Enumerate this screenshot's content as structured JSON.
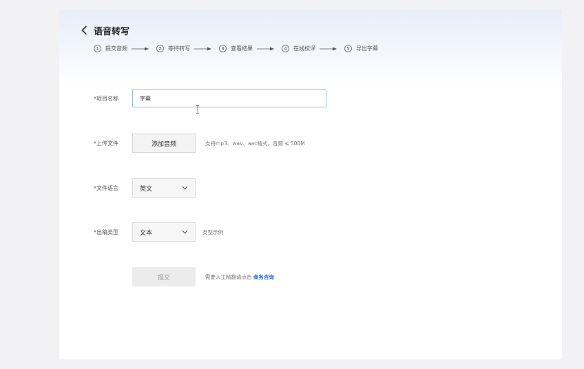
{
  "header": {
    "title": "语音转写"
  },
  "steps": [
    {
      "num": "1",
      "label": "提交音频"
    },
    {
      "num": "2",
      "label": "等待转写"
    },
    {
      "num": "3",
      "label": "查看结果"
    },
    {
      "num": "4",
      "label": "在线校译"
    },
    {
      "num": "5",
      "label": "导出字幕"
    }
  ],
  "form": {
    "project_name": {
      "label": "*项目名称",
      "value": "字幕"
    },
    "upload": {
      "label": "*上传文件",
      "button": "添加音频",
      "hint": "支持mp3、wav、aac格式，音频 ≤ 500M"
    },
    "language": {
      "label": "*文件语言",
      "selected": "英文"
    },
    "output_type": {
      "label": "*出稿类型",
      "selected": "文本",
      "hint": "类型示例"
    },
    "submit": {
      "button": "提交",
      "hint_prefix": "需要人工精翻请点击",
      "link": "商务咨询"
    }
  },
  "colors": {
    "accent": "#2f6fd6",
    "input_border": "#9ab7dd",
    "header_gradient_top": "#e8eef8"
  },
  "icons": {
    "back": "chevron-left-icon",
    "step_arrow": "arrow-right-icon",
    "select_caret": "chevron-down-icon",
    "text_cursor": "text-cursor-icon"
  }
}
